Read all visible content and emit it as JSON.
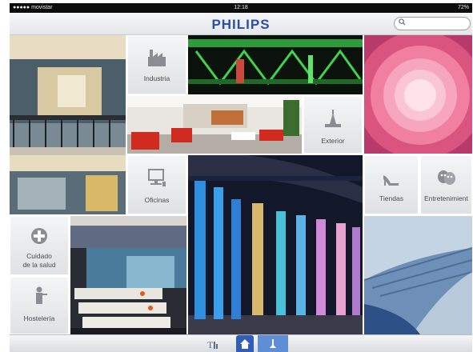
{
  "status": {
    "carrier": "●●●●● movistar",
    "time": "12:18",
    "battery": "72%"
  },
  "header": {
    "brand": "PHILIPS",
    "search_placeholder": ""
  },
  "categories": {
    "industria": "Industria",
    "oficinas": "Oficinas",
    "exterior": "Exterior",
    "tiendas": "Tiendas",
    "entretenimiento": "Entretenimient",
    "cuidado": "Cuidado\nde la salud",
    "hosteleria": "Hostelería"
  },
  "icons": {
    "search": "search-icon",
    "industria": "factory-icon",
    "oficinas": "computer-icon",
    "exterior": "street-lamp-icon",
    "tiendas": "high-heel-icon",
    "entretenimiento": "theatre-masks-icon",
    "cuidado": "medical-cross-icon",
    "hosteleria": "waiter-icon",
    "tab_settings": "settings-text-icon",
    "tab_home": "home-icon",
    "tab_lamp": "lamp-icon"
  },
  "colors": {
    "brand": "#2a4fa8",
    "tab_active": "#2f5fb8",
    "tab_lamp": "#5e8fd6"
  }
}
